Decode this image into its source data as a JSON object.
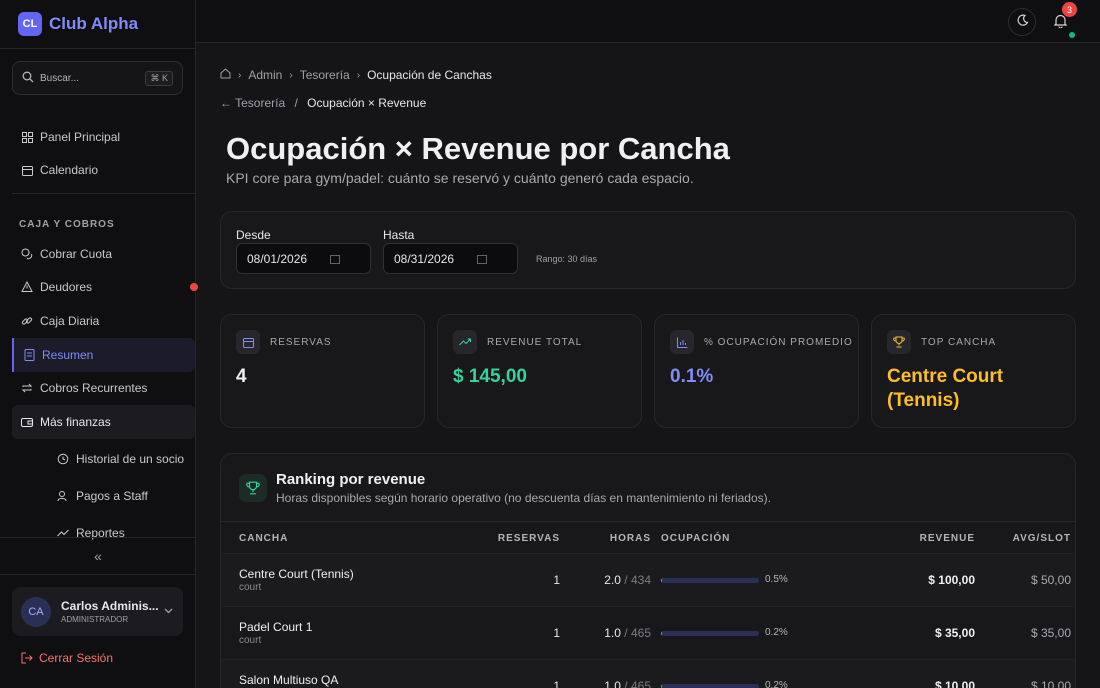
{
  "brand": {
    "initials": "CL",
    "name": "Club Alpha"
  },
  "search": {
    "placeholder": "Buscar...",
    "shortcut": "⌘ K"
  },
  "nav": {
    "panel": "Panel Principal",
    "calendar": "Calendario",
    "section_label": "CAJA Y COBROS",
    "cobrar": "Cobrar Cuota",
    "deudores": "Deudores",
    "caja": "Caja Diaria",
    "resumen": "Resumen",
    "recurrentes": "Cobros Recurrentes",
    "mas_finanzas": "Más finanzas",
    "historial": "Historial de un socio",
    "pagos_staff": "Pagos a Staff",
    "reportes": "Reportes",
    "collapse_glyph": "«"
  },
  "user": {
    "initials": "CA",
    "name": "Carlos Adminis...",
    "role": "ADMINISTRADOR"
  },
  "logout": "Cerrar Sesión",
  "topbar": {
    "notifications": "3"
  },
  "breadcrumb": {
    "admin": "Admin",
    "tesoreria": "Tesorería",
    "current": "Ocupación de Canchas"
  },
  "subcrumb": {
    "back": "← Tesorería",
    "sep": "/",
    "current": "Ocupación × Revenue"
  },
  "page": {
    "title": "Ocupación × Revenue por Cancha",
    "subtitle": "KPI core para gym/padel: cuánto se reservó y cuánto generó cada espacio."
  },
  "filters": {
    "from_label": "Desde",
    "from_value": "08/01/2026",
    "to_label": "Hasta",
    "to_value": "08/31/2026",
    "range": "Rango: 30 días"
  },
  "kpis": {
    "reservas": {
      "label": "RESERVAS",
      "value": "4"
    },
    "revenue": {
      "label": "REVENUE TOTAL",
      "value": "$ 145,00",
      "color": "#34d399"
    },
    "ocupacion": {
      "label": "% OCUPACIÓN PROMEDIO",
      "value": "0.1%",
      "color": "#818cf8"
    },
    "top": {
      "label": "TOP CANCHA",
      "value": "Centre Court (Tennis)",
      "color": "#fbbf24"
    }
  },
  "ranking": {
    "title": "Ranking por revenue",
    "subtitle": "Horas disponibles según horario operativo (no descuenta días en mantenimiento ni feriados).",
    "headers": {
      "cancha": "CANCHA",
      "reservas": "RESERVAS",
      "horas": "HORAS",
      "ocupacion": "OCUPACIÓN",
      "revenue": "REVENUE",
      "avg": "AVG/SLOT"
    },
    "rows": [
      {
        "name": "Centre Court (Tennis)",
        "type": "court",
        "reservas": "1",
        "horas": "2.0",
        "disp": "/ 434",
        "ocupacion": "0.5%",
        "occ_pct": 0.5,
        "revenue": "$ 100,00",
        "avg": "$ 50,00"
      },
      {
        "name": "Padel Court 1",
        "type": "court",
        "reservas": "1",
        "horas": "1.0",
        "disp": "/ 465",
        "ocupacion": "0.2%",
        "occ_pct": 0.2,
        "revenue": "$ 35,00",
        "avg": "$ 35,00"
      },
      {
        "name": "Salon Multiuso QA",
        "type": "",
        "reservas": "1",
        "horas": "1.0",
        "disp": "/ 465",
        "ocupacion": "0.2%",
        "occ_pct": 0.2,
        "revenue": "$ 10,00",
        "avg": "$ 10,00"
      }
    ]
  }
}
